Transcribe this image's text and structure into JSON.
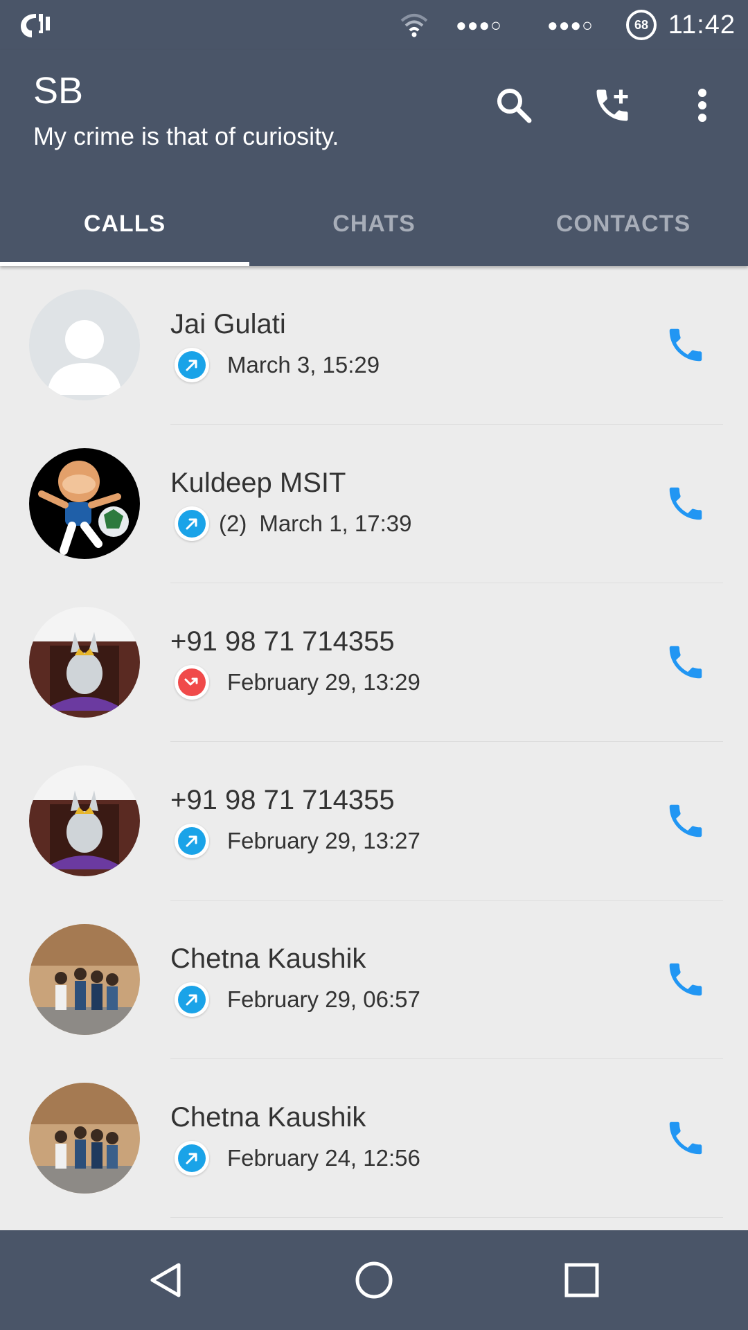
{
  "status_bar": {
    "time": "11:42",
    "battery_level": "68",
    "signal_dots_1": "●●●○",
    "signal_dots_2": "●●●○",
    "icons": [
      "app-notification-icon",
      "wifi-icon",
      "battery-icon"
    ]
  },
  "app_bar": {
    "title": "SB",
    "subtitle": "My crime is that of curiosity.",
    "actions": [
      "search-icon",
      "add-call-icon",
      "more-options-icon"
    ]
  },
  "tabs": [
    {
      "label": "CALLS",
      "active": true
    },
    {
      "label": "CHATS",
      "active": false
    },
    {
      "label": "CONTACTS",
      "active": false
    }
  ],
  "calls": [
    {
      "name": "Jai Gulati",
      "count": "",
      "date": "March 3, 15:29",
      "type": "outgoing"
    },
    {
      "name": "Kuldeep MSIT",
      "count": "(2)",
      "date": "March 1, 17:39",
      "type": "outgoing"
    },
    {
      "name": "+91 98 71 714355",
      "count": "",
      "date": "February 29, 13:29",
      "type": "missed"
    },
    {
      "name": "+91 98 71 714355",
      "count": "",
      "date": "February 29, 13:27",
      "type": "outgoing"
    },
    {
      "name": "Chetna Kaushik",
      "count": "",
      "date": "February 29, 06:57",
      "type": "outgoing"
    },
    {
      "name": "Chetna Kaushik",
      "count": "",
      "date": "February 24, 12:56",
      "type": "outgoing"
    }
  ],
  "colors": {
    "bar": "#4a5568",
    "outgoing": "#1aa3e8",
    "missed": "#f04a4a",
    "call_button": "#2196f3"
  },
  "nav_bar": [
    "back-icon",
    "home-icon",
    "recents-icon"
  ]
}
